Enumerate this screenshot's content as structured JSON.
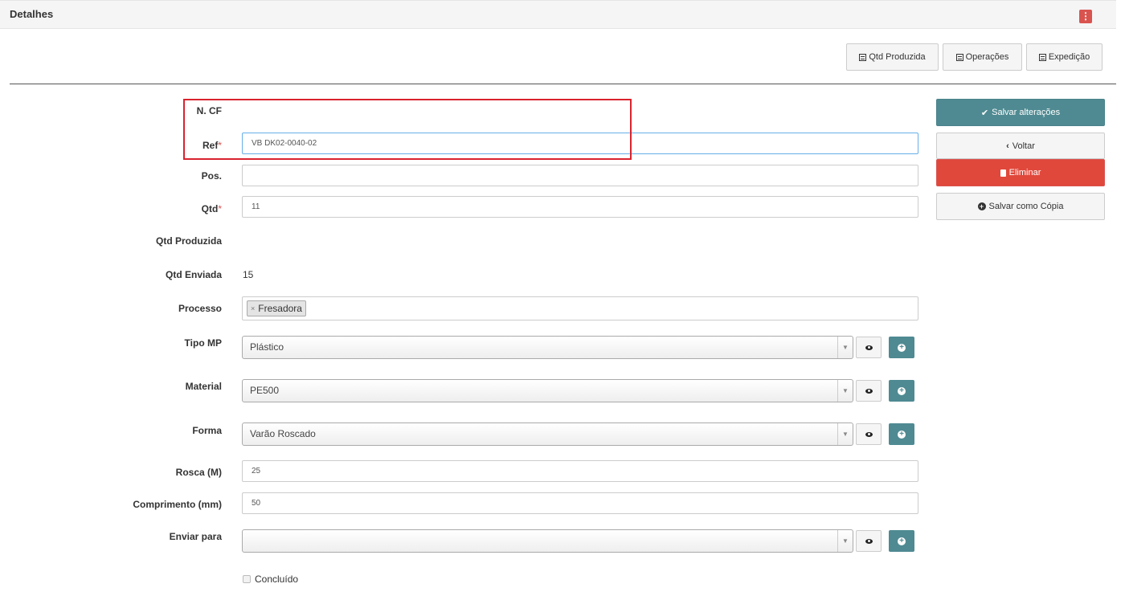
{
  "panel": {
    "title": "Detalhes",
    "menu_icon": "⋮"
  },
  "toolbar": {
    "qtd_produzida": "Qtd Produzida",
    "operacoes": "Operações",
    "expedicao": "Expedição"
  },
  "form": {
    "ncf": {
      "label": "N. CF",
      "value": ""
    },
    "ref": {
      "label": "Ref",
      "required": "*",
      "value": "VB DK02-0040-02"
    },
    "pos": {
      "label": "Pos.",
      "value": ""
    },
    "qtd": {
      "label": "Qtd",
      "required": "*",
      "value": "11"
    },
    "qtd_produzida": {
      "label": "Qtd Produzida",
      "value": ""
    },
    "qtd_enviada": {
      "label": "Qtd Enviada",
      "value": "15"
    },
    "processo": {
      "label": "Processo",
      "tags": [
        "Fresadora"
      ],
      "remove_glyph": "×"
    },
    "tipo_mp": {
      "label": "Tipo MP",
      "value": "Plástico"
    },
    "material": {
      "label": "Material",
      "value": "PE500"
    },
    "forma": {
      "label": "Forma",
      "value": "Varão Roscado"
    },
    "rosca": {
      "label": "Rosca (M)",
      "value": "25"
    },
    "comprimento": {
      "label": "Comprimento (mm)",
      "value": "50"
    },
    "enviar_para": {
      "label": "Enviar para",
      "value": ""
    },
    "concluido": {
      "label": "Concluído",
      "checked": false
    }
  },
  "actions": {
    "save": "Salvar alterações",
    "back": "Voltar",
    "delete": "Eliminar",
    "save_copy": "Salvar como Cópia"
  },
  "colors": {
    "primary": "#4f8a92",
    "danger": "#e0483b",
    "highlight": "#d9232e"
  }
}
